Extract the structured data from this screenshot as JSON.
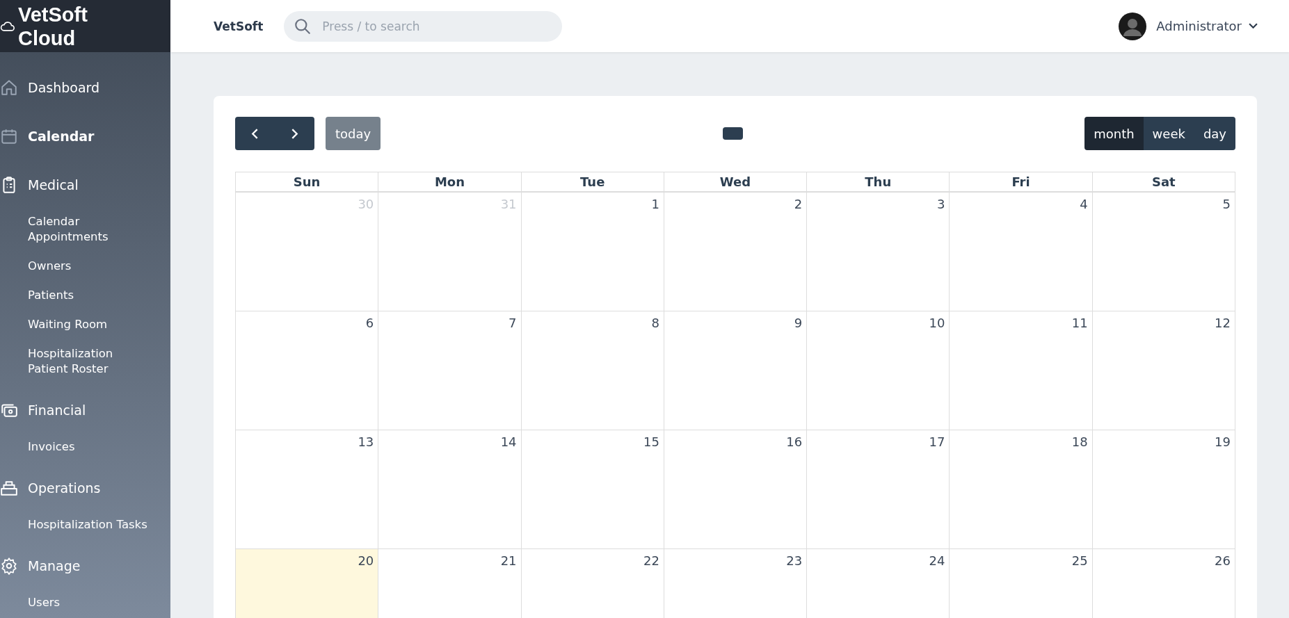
{
  "sidebar": {
    "brand": "VetSoft Cloud",
    "items": [
      {
        "label": "Dashboard",
        "kind": "home",
        "selected": false
      },
      {
        "label": "Calendar",
        "kind": "calendar",
        "selected": true
      },
      {
        "label": "Medical",
        "kind": "clipboard",
        "selected": false,
        "children": [
          {
            "label": "Calendar Appointments",
            "selected": false
          },
          {
            "label": "Owners",
            "selected": false
          },
          {
            "label": "Patients",
            "selected": false
          },
          {
            "label": "Waiting Room",
            "selected": false
          },
          {
            "label": "Hospitalization Patient Roster",
            "selected": false
          }
        ]
      },
      {
        "label": "Financial",
        "kind": "money",
        "selected": false,
        "children": [
          {
            "label": "Invoices",
            "selected": false
          }
        ]
      },
      {
        "label": "Operations",
        "kind": "tray",
        "selected": false,
        "children": [
          {
            "label": "Hospitalization Tasks",
            "selected": false
          }
        ]
      },
      {
        "label": "Manage",
        "kind": "gear",
        "selected": false,
        "children": [
          {
            "label": "Users",
            "selected": false
          }
        ]
      }
    ]
  },
  "header": {
    "app_name": "VetSoft",
    "search": {
      "placeholder": "Press / to search"
    },
    "user": "Administrator"
  },
  "calendar": {
    "today_button": "today",
    "views": [
      {
        "label": "month",
        "selected": true
      },
      {
        "label": "week",
        "selected": false
      },
      {
        "label": "day",
        "selected": false
      }
    ],
    "weekdays": [
      "Sun",
      "Mon",
      "Tue",
      "Wed",
      "Thu",
      "Fri",
      "Sat"
    ],
    "weeks": [
      [
        {
          "day": "30",
          "other_month": true,
          "today": false
        },
        {
          "day": "31",
          "other_month": true,
          "today": false
        },
        {
          "day": "1",
          "other_month": false,
          "today": false
        },
        {
          "day": "2",
          "other_month": false,
          "today": false
        },
        {
          "day": "3",
          "other_month": false,
          "today": false
        },
        {
          "day": "4",
          "other_month": false,
          "today": false
        },
        {
          "day": "5",
          "other_month": false,
          "today": false
        }
      ],
      [
        {
          "day": "6",
          "other_month": false,
          "today": false
        },
        {
          "day": "7",
          "other_month": false,
          "today": false
        },
        {
          "day": "8",
          "other_month": false,
          "today": false
        },
        {
          "day": "9",
          "other_month": false,
          "today": false
        },
        {
          "day": "10",
          "other_month": false,
          "today": false
        },
        {
          "day": "11",
          "other_month": false,
          "today": false
        },
        {
          "day": "12",
          "other_month": false,
          "today": false
        }
      ],
      [
        {
          "day": "13",
          "other_month": false,
          "today": false
        },
        {
          "day": "14",
          "other_month": false,
          "today": false
        },
        {
          "day": "15",
          "other_month": false,
          "today": false
        },
        {
          "day": "16",
          "other_month": false,
          "today": false
        },
        {
          "day": "17",
          "other_month": false,
          "today": false
        },
        {
          "day": "18",
          "other_month": false,
          "today": false
        },
        {
          "day": "19",
          "other_month": false,
          "today": false
        }
      ],
      [
        {
          "day": "20",
          "other_month": false,
          "today": true
        },
        {
          "day": "21",
          "other_month": false,
          "today": false
        },
        {
          "day": "22",
          "other_month": false,
          "today": false
        },
        {
          "day": "23",
          "other_month": false,
          "today": false
        },
        {
          "day": "24",
          "other_month": false,
          "today": false
        },
        {
          "day": "25",
          "other_month": false,
          "today": false
        },
        {
          "day": "26",
          "other_month": false,
          "today": false
        }
      ]
    ]
  }
}
